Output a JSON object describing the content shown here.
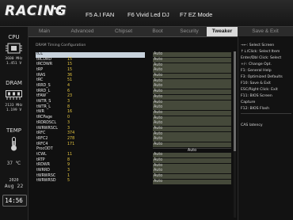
{
  "header": {
    "logo_text": "RACING",
    "fn_keys": [
      "F5 A.I FAN",
      "F6 Vivid Led DJ",
      "F7 EZ Mode"
    ]
  },
  "sidebar": {
    "cpu": {
      "label": "CPU",
      "value1": "3600 MHz",
      "value2": "1.451 V"
    },
    "dram": {
      "label": "DRAM",
      "value1": "2133 MHz",
      "value2": "1.199 V"
    },
    "temp": {
      "label": "TEMP",
      "value": "37 ℃"
    },
    "date": {
      "year": "2020",
      "day": "Aug 22"
    },
    "clock": "14:56"
  },
  "tabs": [
    "Main",
    "Advanced",
    "Chipset",
    "Boot",
    "Security",
    "Tweaker"
  ],
  "active_tab": "Tweaker",
  "exit_tab": "Save & Exit",
  "main": {
    "section_title": "DRAM Timing Configuration",
    "rows": [
      {
        "label": "tCL",
        "num": "",
        "value": "Auto",
        "selected": true
      },
      {
        "label": "tRCDRD",
        "num": "15",
        "value": "Auto"
      },
      {
        "label": "tRCDWR",
        "num": "15",
        "value": "Auto"
      },
      {
        "label": "tRP",
        "num": "15",
        "value": "Auto"
      },
      {
        "label": "tRAS",
        "num": "36",
        "value": "Auto"
      },
      {
        "label": "tRC",
        "num": "51",
        "value": "Auto"
      },
      {
        "label": "tRRD_S",
        "num": "4",
        "value": "Auto"
      },
      {
        "label": "tRRD_L",
        "num": "6",
        "value": "Auto"
      },
      {
        "label": "tFAW",
        "num": "23",
        "value": "Auto"
      },
      {
        "label": "tWTR_S",
        "num": "3",
        "value": "Auto"
      },
      {
        "label": "tWTR_L",
        "num": "8",
        "value": "Auto"
      },
      {
        "label": "tWR",
        "num": "16",
        "value": "Auto"
      },
      {
        "label": "tRCPage",
        "num": "0",
        "value": "Auto"
      },
      {
        "label": "tRDRDSCL",
        "num": "3",
        "value": "Auto"
      },
      {
        "label": "tWRWRSCL",
        "num": "3",
        "value": "Auto"
      },
      {
        "label": "tRFC",
        "num": "374",
        "value": "Auto"
      },
      {
        "label": "tRFC2",
        "num": "278",
        "value": "Auto"
      },
      {
        "label": "tRFC4",
        "num": "171",
        "value": "Auto"
      },
      {
        "label": "ProcODT",
        "num": "",
        "value": "Auto",
        "plain": true
      },
      {
        "label": "tCWL",
        "num": "11",
        "value": "Auto"
      },
      {
        "label": "tRTP",
        "num": "8",
        "value": "Auto"
      },
      {
        "label": "tRDWR",
        "num": "9",
        "value": "Auto"
      },
      {
        "label": "tWRRD",
        "num": "3",
        "value": "Auto"
      },
      {
        "label": "tWRWRSC",
        "num": "1",
        "value": "Auto"
      },
      {
        "label": "tWRWRSD",
        "num": "5",
        "value": "Auto"
      }
    ]
  },
  "help": {
    "lines": [
      "→←: Select Screen",
      "↑↓/Click: Select Item",
      "Enter/Dbl Click: Select",
      "+/-: Change Opt.",
      "F1: General Help",
      "F3: Optimized Defaults",
      "F10: Save & Exit",
      "ESC/Right Click: Exit",
      "F11: BIOS Screen",
      "Capture",
      "F12: BIOS Flash"
    ],
    "description": "CAS latency"
  }
}
